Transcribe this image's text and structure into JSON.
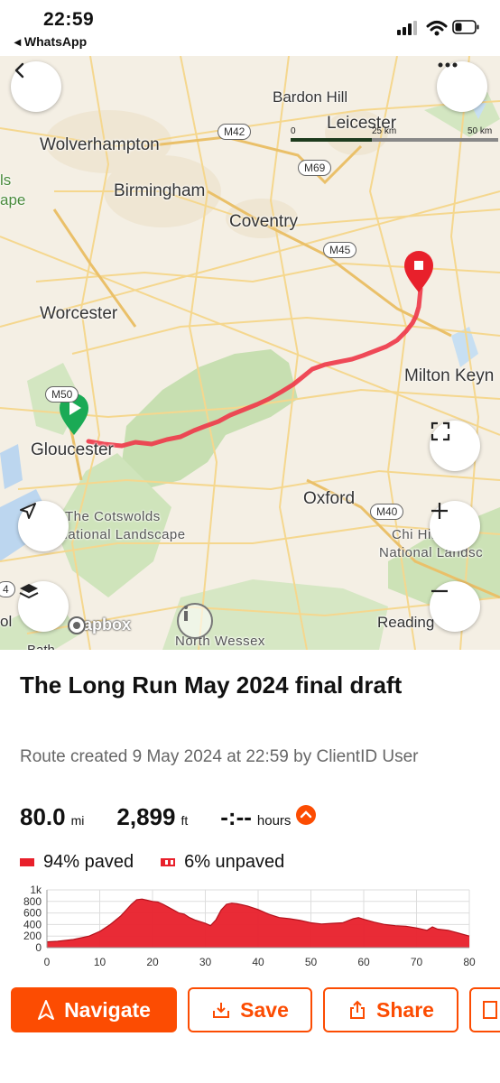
{
  "status_bar": {
    "time": "22:59",
    "back_app": "◂ WhatsApp"
  },
  "map": {
    "places": {
      "wolverhampton": "Wolverhampton",
      "birmingham": "Birmingham",
      "coventry": "Coventry",
      "leicester": "Leicester",
      "bardon_hill": "Bardon Hill",
      "worcester": "Worcester",
      "milton_keynes": "Milton Keyn",
      "gloucester": "Gloucester",
      "oxford": "Oxford",
      "cotswolds_1": "The Cotswolds",
      "cotswolds_2": "National Landscape",
      "chilterns_1": "Chi      Hills",
      "chilterns_2": "National Landsc",
      "reading": "Reading",
      "north_wessex": "North Wessex",
      "left_edge_1": "ls",
      "left_edge_2": "ape",
      "left_edge_3": "ol",
      "left_edge_4": "4",
      "bottom_edge": "Bath"
    },
    "roads": {
      "m42": "M42",
      "m69": "M69",
      "m45": "M45",
      "m50": "M50",
      "m40": "M40"
    },
    "scale": {
      "start": "0",
      "mid": "25 km",
      "end": "50 km"
    },
    "attribution": "mapbox"
  },
  "route": {
    "title": "The Long Run May 2024 final draft",
    "meta": "Route created 9 May 2024 at 22:59 by ClientID User",
    "distance": "80.0",
    "distance_unit": "mi",
    "elevation": "2,899",
    "elevation_unit": "ft",
    "time": "-:--",
    "time_unit": "hours",
    "paved": "94% paved",
    "unpaved": "6% unpaved"
  },
  "chart_data": {
    "type": "area",
    "xlabel": "",
    "ylabel": "",
    "x_ticks": [
      "0",
      "10",
      "20",
      "30",
      "40",
      "50",
      "60",
      "70",
      "80"
    ],
    "y_ticks": [
      "0",
      "200",
      "400",
      "600",
      "800",
      "1k"
    ],
    "xlim": [
      0,
      80
    ],
    "ylim": [
      0,
      1000
    ],
    "grid": true,
    "series": [
      {
        "x": [
          0,
          2,
          5,
          8,
          10,
          12,
          14,
          15,
          16,
          17,
          18,
          19,
          20,
          21,
          22,
          23,
          24,
          25,
          26,
          27,
          28,
          29,
          30,
          31,
          32,
          33,
          34,
          35,
          36,
          37,
          38,
          40,
          42,
          44,
          46,
          48,
          50,
          52,
          54,
          56,
          58,
          59,
          60,
          62,
          64,
          66,
          68,
          70,
          72,
          73,
          74,
          76,
          78,
          80
        ],
        "values": [
          100,
          110,
          140,
          200,
          280,
          400,
          550,
          650,
          750,
          830,
          840,
          820,
          800,
          790,
          750,
          700,
          650,
          600,
          580,
          520,
          480,
          450,
          420,
          380,
          480,
          650,
          750,
          770,
          760,
          740,
          720,
          660,
          580,
          520,
          500,
          470,
          430,
          410,
          420,
          430,
          500,
          520,
          490,
          440,
          400,
          380,
          370,
          340,
          300,
          360,
          320,
          300,
          250,
          200
        ]
      }
    ]
  },
  "buttons": {
    "navigate": "Navigate",
    "save": "Save",
    "share": "Share"
  }
}
